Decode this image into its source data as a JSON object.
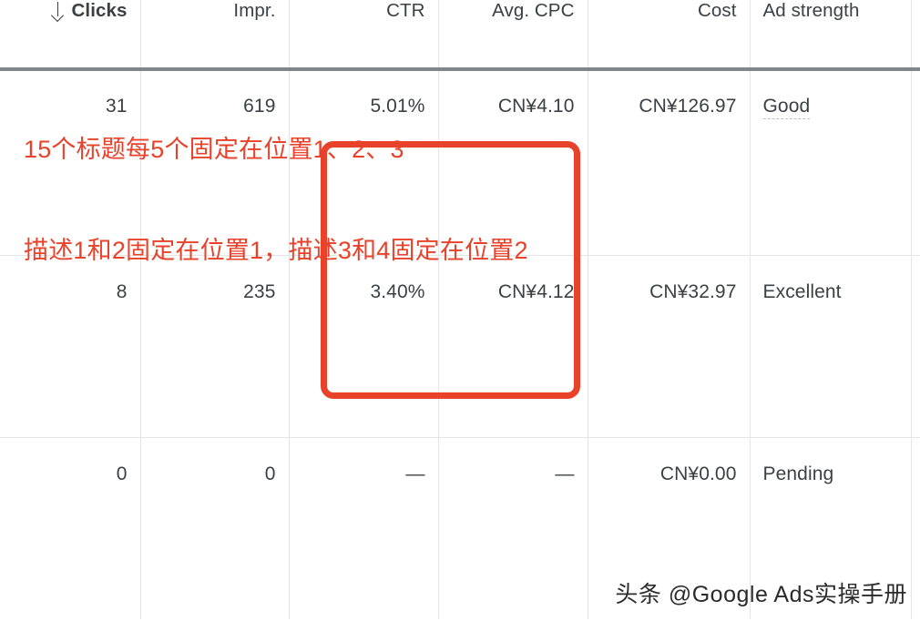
{
  "table": {
    "columns": [
      {
        "key": "clicks",
        "label": "Clicks",
        "align": "right",
        "sorted": true,
        "sort_icon": "arrow-down-icon",
        "sort_direction": "descending",
        "bold": true
      },
      {
        "key": "impr",
        "label": "Impr.",
        "align": "right",
        "sorted": false,
        "bold": false
      },
      {
        "key": "ctr",
        "label": "CTR",
        "align": "right",
        "sorted": false,
        "bold": false
      },
      {
        "key": "avg_cpc",
        "label": "Avg. CPC",
        "align": "right",
        "sorted": false,
        "bold": false
      },
      {
        "key": "cost",
        "label": "Cost",
        "align": "right",
        "sorted": false,
        "bold": false
      },
      {
        "key": "strength",
        "label": "Ad strength",
        "align": "left",
        "sorted": false,
        "bold": false
      }
    ],
    "rows": [
      {
        "clicks": "31",
        "impr": "619",
        "ctr": "5.01%",
        "avg_cpc": "CN¥4.10",
        "cost": "CN¥126.97",
        "strength": "Good",
        "strength_has_tooltip_underline": true
      },
      {
        "clicks": "8",
        "impr": "235",
        "ctr": "3.40%",
        "avg_cpc": "CN¥4.12",
        "cost": "CN¥32.97",
        "strength": "Excellent",
        "strength_has_tooltip_underline": false
      },
      {
        "clicks": "0",
        "impr": "0",
        "ctr": "—",
        "avg_cpc": "—",
        "cost": "CN¥0.00",
        "strength": "Pending",
        "strength_has_tooltip_underline": false
      }
    ]
  },
  "annotation": {
    "color": "#e8422a",
    "line1": "15个标题每5个固定在位置1、2、3",
    "line2": "描述1和2固定在位置1，描述3和4固定在位置2",
    "highlight_box": {
      "covers_columns": [
        "CTR",
        "Avg. CPC"
      ],
      "covers_rows": [
        1,
        2
      ],
      "color": "#e8422a"
    }
  },
  "watermark": {
    "text": "头条 @Google Ads实操手册"
  },
  "colors": {
    "text": "#3c4043",
    "grid_line": "#e4e5e7",
    "header_rule": "#80868b",
    "annotation_red": "#e8422a",
    "background": "#ffffff"
  }
}
